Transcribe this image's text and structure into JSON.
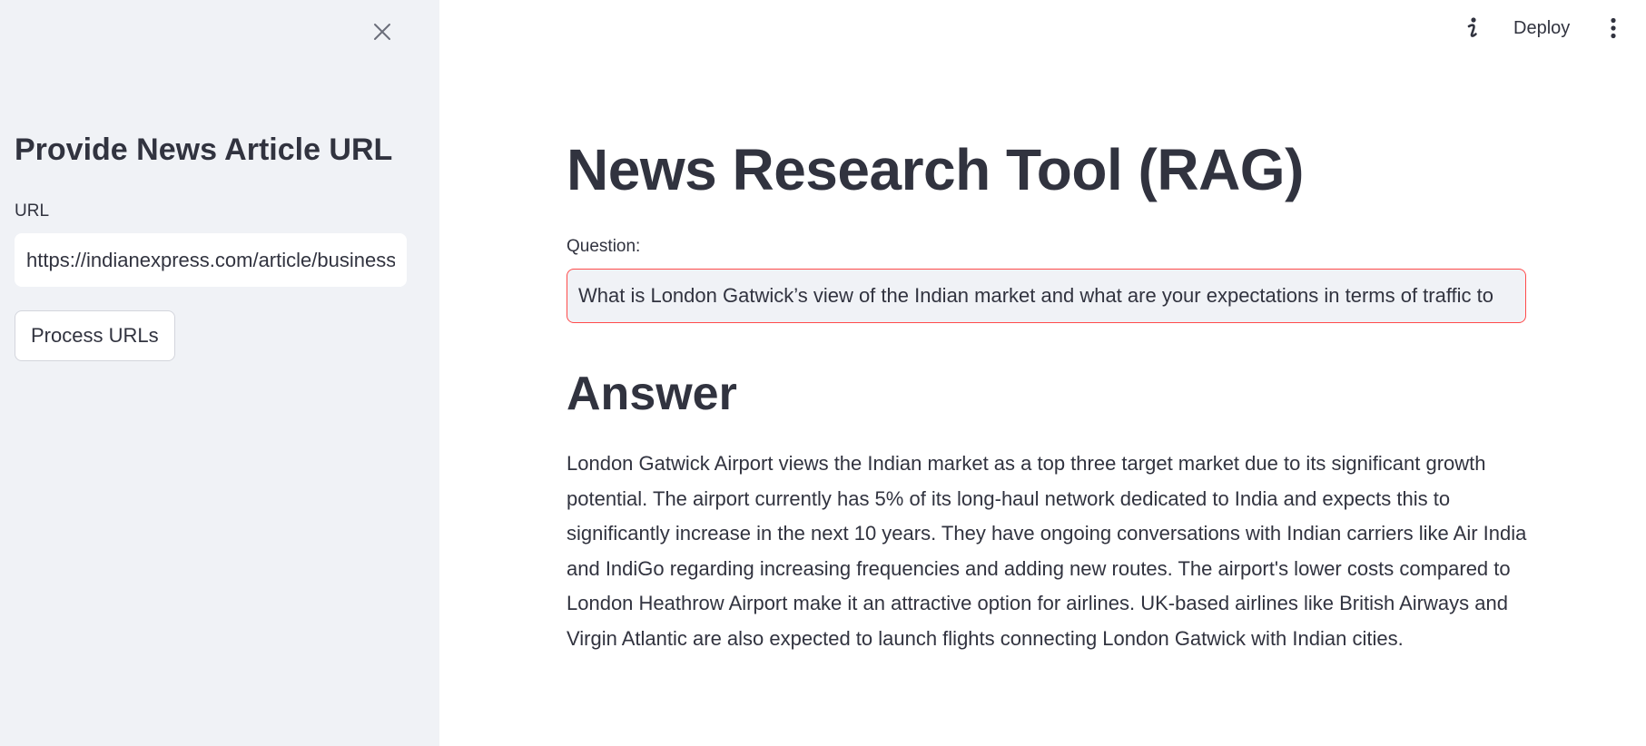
{
  "sidebar": {
    "header": "Provide News Article URL",
    "url_label": "URL",
    "url_value": "https://indianexpress.com/article/business",
    "process_button_label": "Process URLs"
  },
  "toolbar": {
    "info_icon": "info-icon",
    "deploy_label": "Deploy",
    "menu_icon": "vertical-ellipsis-icon"
  },
  "main": {
    "title": "News Research Tool (RAG)",
    "question_label": "Question:",
    "question_value": "What is London Gatwick’s view of the Indian market and what are your expectations in terms of traffic to",
    "answer_heading": "Answer",
    "answer_text": "London Gatwick Airport views the Indian market as a top three target market due to its significant growth potential. The airport currently has 5% of its long-haul network dedicated to India and expects this to significantly increase in the next 10 years. They have ongoing conversations with Indian carriers like Air India and IndiGo regarding increasing frequencies and adding new routes. The airport's lower costs compared to London Heathrow Airport make it an attractive option for airlines. UK-based airlines like British Airways and Virgin Atlantic are also expected to launch flights connecting London Gatwick with Indian cities."
  },
  "colors": {
    "sidebar_bg": "#f0f2f6",
    "text": "#31333f",
    "focus_border": "#ff4b4b"
  }
}
